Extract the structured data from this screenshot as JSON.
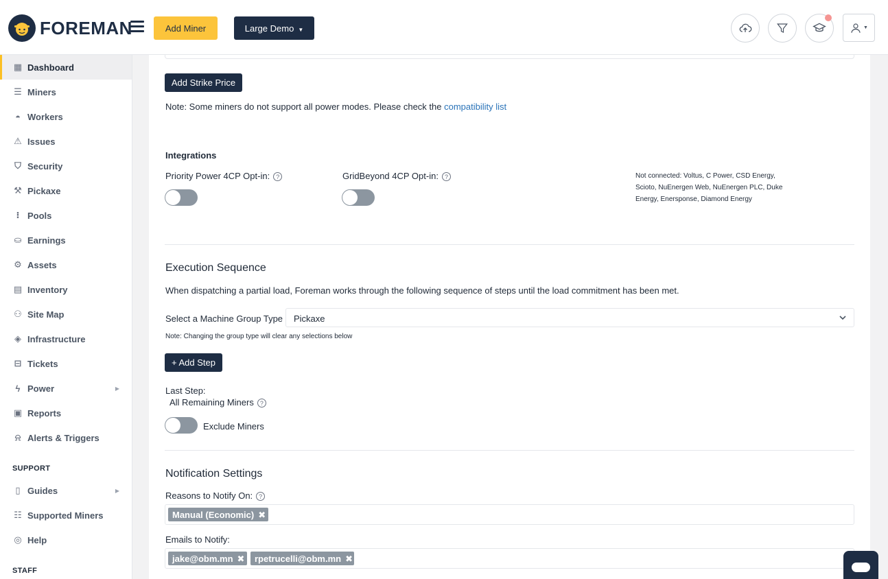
{
  "header": {
    "brand": "FOREMAN",
    "add_miner_label": "Add Miner",
    "demo_label": "Large Demo"
  },
  "sidebar": {
    "items": [
      {
        "label": "Dashboard",
        "icon": "dashboard-icon",
        "active": true
      },
      {
        "label": "Miners",
        "icon": "server-icon"
      },
      {
        "label": "Workers",
        "icon": "hardhat-icon"
      },
      {
        "label": "Issues",
        "icon": "warning-icon"
      },
      {
        "label": "Security",
        "icon": "shield-icon"
      },
      {
        "label": "Pickaxe",
        "icon": "pickaxe-icon"
      },
      {
        "label": "Pools",
        "icon": "pools-icon"
      },
      {
        "label": "Earnings",
        "icon": "earnings-icon"
      },
      {
        "label": "Assets",
        "icon": "chip-icon"
      },
      {
        "label": "Inventory",
        "icon": "inventory-icon"
      },
      {
        "label": "Site Map",
        "icon": "sitemap-icon"
      },
      {
        "label": "Infrastructure",
        "icon": "layers-icon"
      },
      {
        "label": "Tickets",
        "icon": "ticket-icon"
      },
      {
        "label": "Power",
        "icon": "bolt-icon"
      },
      {
        "label": "Reports",
        "icon": "report-icon"
      },
      {
        "label": "Alerts & Triggers",
        "icon": "alert-icon"
      }
    ],
    "support_title": "SUPPORT",
    "support_items": [
      {
        "label": "Guides",
        "icon": "book-icon"
      },
      {
        "label": "Supported Miners",
        "icon": "list-icon"
      },
      {
        "label": "Help",
        "icon": "lifebuoy-icon"
      }
    ],
    "staff_title": "STAFF"
  },
  "main": {
    "add_strike_label": "Add Strike Price",
    "note_prefix": "Note: Some miners do not support all power modes. Please check the ",
    "note_link": "compatibility list",
    "integrations_title": "Integrations",
    "priority_label": "Priority Power 4CP Opt-in:",
    "gridbeyond_label": "GridBeyond 4CP Opt-in:",
    "not_connected_line1": "Not connected: Voltus, C Power, CSD Energy,",
    "not_connected_line2": "Scioto, NuEnergen Web, NuEnergen PLC, Duke",
    "not_connected_line3": "Energy, Enersponse, Diamond Energy",
    "exec_title": "Execution Sequence",
    "exec_desc": "When dispatching a partial load, Foreman works through the following sequence of steps until the load commitment has been met.",
    "group_type_label": "Select a Machine Group Type",
    "group_type_value": "Pickaxe",
    "group_type_note": "Note: Changing the group type will clear any selections below",
    "add_step_label": "+ Add Step",
    "last_step_label": "Last Step:",
    "remaining_label": "All Remaining Miners",
    "exclude_label": "Exclude Miners",
    "notif_title": "Notification Settings",
    "reasons_label": "Reasons to Notify On:",
    "reasons": [
      "Manual (Economic)"
    ],
    "emails_label": "Emails to Notify:",
    "emails": [
      "jake@obm.mn",
      "rpetrucelli@obm.mn"
    ]
  }
}
